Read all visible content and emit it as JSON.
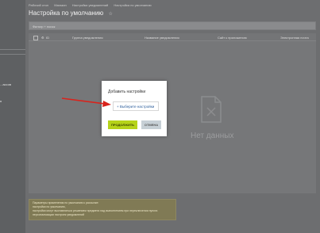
{
  "sidebar": {
    "fragments": [
      "...ассов",
      "я"
    ]
  },
  "breadcrumbs": [
    "Рабочий стол",
    "Магазин",
    "Настройки уведомлений",
    "Настройка по умолчанию"
  ],
  "page": {
    "title": "Настройка по умолчанию",
    "star_icon": "star-icon"
  },
  "search": {
    "placeholder": "Фильтр + поиск"
  },
  "table": {
    "columns": [
      "ID",
      "Группа уведомления",
      "Название уведомления",
      "Сайт к приложению",
      "Электронная почта"
    ]
  },
  "empty_state": {
    "text": "Нет данных",
    "icon": "empty-document-icon"
  },
  "info_box": {
    "lines": [
      "Параметры применения по умолчанию к рассылке:",
      "настройки по умолчанию,",
      "настройки могут выставляться решением предмета над выполнением при переключении пункта",
      "персонализации настроек уведомлений"
    ]
  },
  "modal": {
    "title": "Добавить настройки",
    "select_label": "+ Выберите настройки",
    "continue_label": "ПРОДОЛЖИТЬ",
    "cancel_label": "ОТМЕНА"
  },
  "colors": {
    "accent_green": "#b6d31a",
    "arrow_red": "#d9231c",
    "link_blue": "#2a5c9a"
  }
}
